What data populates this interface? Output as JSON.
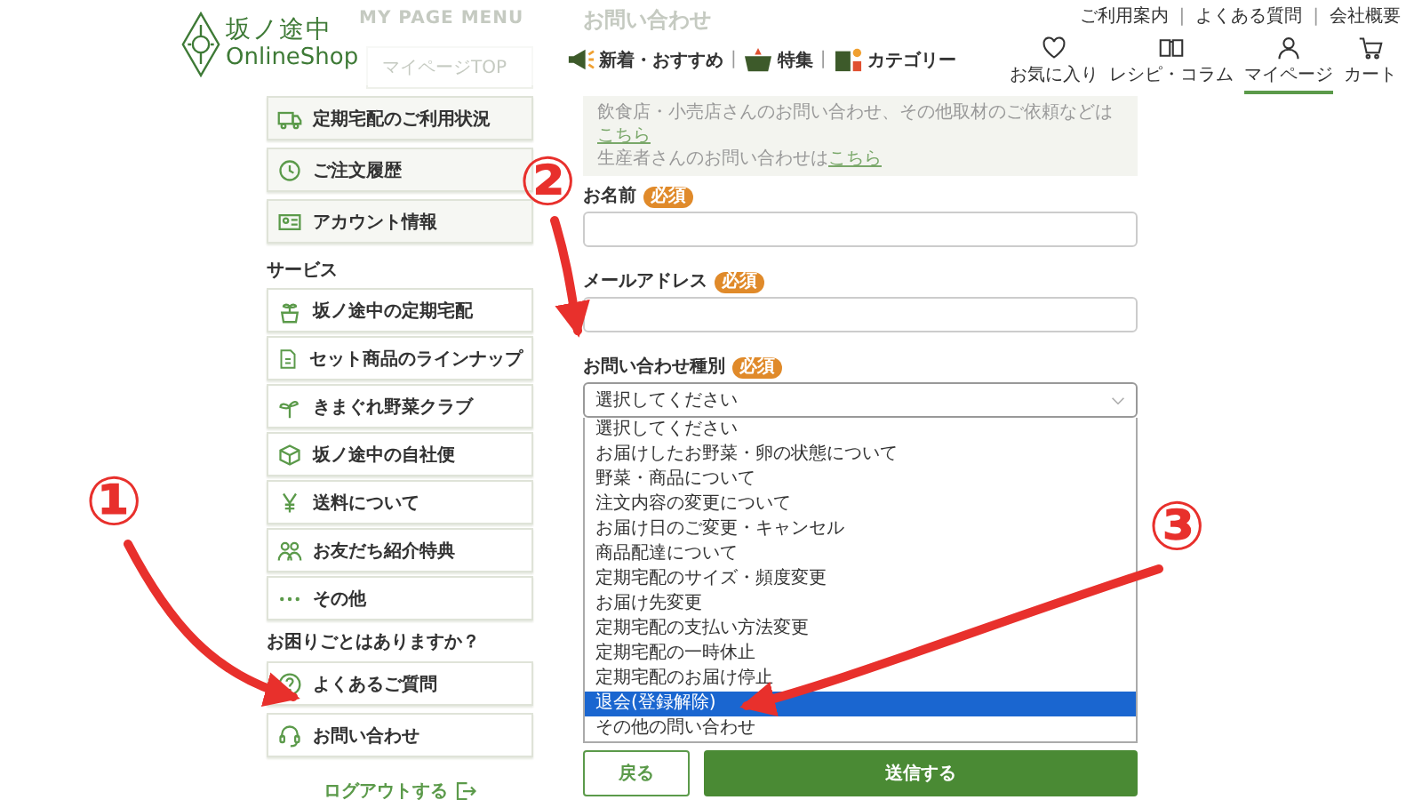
{
  "header": {
    "logo": {
      "title": "坂ノ途中",
      "subtitle": "OnlineShop"
    },
    "top_links": [
      "ご利用案内",
      "よくある質問",
      "会社概要"
    ],
    "top_link_separators": [
      "|",
      "|"
    ],
    "nav_separators": [
      "|",
      "|"
    ],
    "nav": [
      {
        "label": "新着・おすすめ",
        "kind": "megaphone"
      },
      {
        "label": "特集",
        "kind": "basket"
      },
      {
        "label": "カテゴリー",
        "kind": "category"
      }
    ],
    "icons": [
      {
        "label": "お気に入り",
        "kind": "heart",
        "selected": false
      },
      {
        "label": "レシピ・コラム",
        "kind": "book",
        "selected": false
      },
      {
        "label": "マイページ",
        "kind": "person",
        "selected": true
      },
      {
        "label": "カート",
        "kind": "cart",
        "selected": false
      }
    ]
  },
  "sidebar": {
    "heading": "MY PAGE MENU",
    "top_item": "マイページTOP",
    "account_items": [
      {
        "label": "定期宅配のご利用状況",
        "kind": "truck"
      },
      {
        "label": "ご注文履歴",
        "kind": "clock"
      },
      {
        "label": "アカウント情報",
        "kind": "card"
      }
    ],
    "services_heading": "サービス",
    "service_items": [
      {
        "label": "坂ノ途中の定期宅配",
        "kind": "sprout-bag"
      },
      {
        "label": "セット商品のラインナップ",
        "kind": "doc"
      },
      {
        "label": "きまぐれ野菜クラブ",
        "kind": "sprout"
      },
      {
        "label": "坂ノ途中の自社便",
        "kind": "box"
      },
      {
        "label": "送料について",
        "kind": "yen"
      },
      {
        "label": "お友だち紹介特典",
        "kind": "people"
      },
      {
        "label": "その他",
        "kind": "dots"
      }
    ],
    "help_heading": "お困りごとはありますか？",
    "help_items": [
      {
        "label": "よくあるご質問",
        "kind": "question"
      },
      {
        "label": "お問い合わせ",
        "kind": "headset"
      }
    ],
    "logout": "ログアウトする"
  },
  "form": {
    "title": "お問い合わせ",
    "notice": [
      {
        "text": "飲食店・小売店さんのお問い合わせ、その他取材のご依頼などは",
        "link": "こちら"
      },
      {
        "text": "生産者さんのお問い合わせは",
        "link": "こちら"
      }
    ],
    "fields": [
      {
        "label": "お名前",
        "badge": "必須",
        "kind": "text"
      },
      {
        "label": "メールアドレス",
        "badge": "必須",
        "kind": "text"
      },
      {
        "label": "お問い合わせ種別",
        "badge": "必須",
        "kind": "select",
        "value": "選択してください"
      }
    ],
    "options": [
      {
        "label": "選択してください",
        "selected": false
      },
      {
        "label": "お届けしたお野菜・卵の状態について",
        "selected": false
      },
      {
        "label": "野菜・商品について",
        "selected": false
      },
      {
        "label": "注文内容の変更について",
        "selected": false
      },
      {
        "label": "お届け日のご変更・キャンセル",
        "selected": false
      },
      {
        "label": "商品配達について",
        "selected": false
      },
      {
        "label": "定期宅配のサイズ・頻度変更",
        "selected": false
      },
      {
        "label": "お届け先変更",
        "selected": false
      },
      {
        "label": "定期宅配の支払い方法変更",
        "selected": false
      },
      {
        "label": "定期宅配の一時休止",
        "selected": false
      },
      {
        "label": "定期宅配のお届け停止",
        "selected": false
      },
      {
        "label": "退会(登録解除)",
        "selected": true
      },
      {
        "label": "その他の問い合わせ",
        "selected": false
      }
    ],
    "buttons": [
      {
        "label": "戻る",
        "kind": "secondary"
      },
      {
        "label": "送信する",
        "kind": "primary"
      }
    ]
  },
  "annotations": [
    {
      "label": "①"
    },
    {
      "label": "②"
    },
    {
      "label": "③"
    }
  ]
}
